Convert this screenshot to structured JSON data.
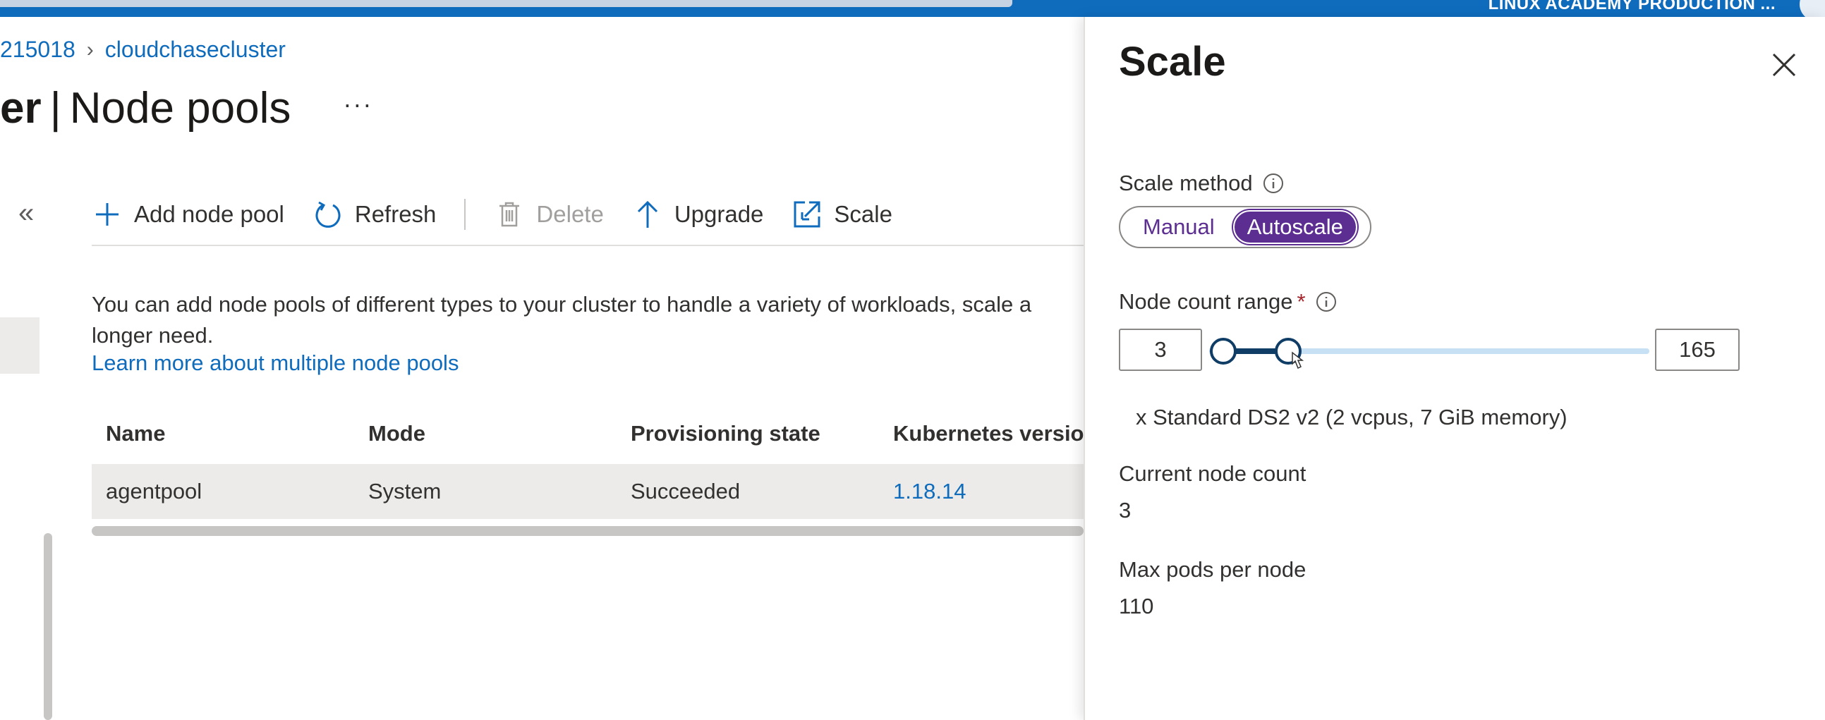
{
  "topbar": {
    "tenant": "LINUX ACADEMY PRODUCTION ..."
  },
  "breadcrumb": {
    "parent": "215018",
    "current": "cloudchasecluster"
  },
  "page": {
    "title_prefix": "er",
    "title_main": "Node pools",
    "more": "···"
  },
  "nav": {
    "collapse": "«"
  },
  "toolbar": {
    "add_label": "Add node pool",
    "refresh_label": "Refresh",
    "delete_label": "Delete",
    "upgrade_label": "Upgrade",
    "scale_label": "Scale"
  },
  "description": {
    "line1": "You can add node pools of different types to your cluster to handle a variety of workloads, scale a",
    "line2": "longer need.",
    "link": "Learn more about multiple node pools"
  },
  "table": {
    "headers": [
      "Name",
      "Mode",
      "Provisioning state",
      "Kubernetes version"
    ],
    "rows": [
      {
        "name": "agentpool",
        "mode": "System",
        "state": "Succeeded",
        "version": "1.18.14"
      }
    ]
  },
  "panel": {
    "title": "Scale",
    "scale_method_label": "Scale method",
    "scale_method_options": [
      "Manual",
      "Autoscale"
    ],
    "scale_method_selected": "Autoscale",
    "node_range_label": "Node count range",
    "required_mark": "*",
    "node_min": "3",
    "node_max": "165",
    "vm_size": "x Standard DS2 v2 (2 vcpus, 7 GiB memory)",
    "current_count_label": "Current node count",
    "current_count": "3",
    "max_pods_label": "Max pods per node",
    "max_pods": "110"
  },
  "colors": {
    "azure_blue": "#0f6cbd",
    "toggle_purple": "#5c2e91",
    "slider_track": "#c7e0f4",
    "slider_fill": "#0f3d66"
  },
  "icons": [
    "plus-icon",
    "refresh-icon",
    "trash-icon",
    "arrow-up-icon",
    "scale-icon",
    "info-icon",
    "close-icon",
    "chevron-double-left-icon",
    "ellipsis-icon"
  ]
}
